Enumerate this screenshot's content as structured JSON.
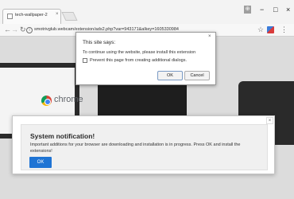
{
  "browser": {
    "tab": {
      "title": "tech-wallpaper-2",
      "close": "×"
    },
    "window": {
      "profile": "⊕",
      "minimize": "−",
      "maximize": "□",
      "close": "×"
    },
    "toolbar": {
      "back": "←",
      "forward": "→",
      "reload": "↻",
      "star": "☆",
      "menu": "⋮"
    },
    "address_bar": {
      "info": "i",
      "url": "smotrivglub.webcam/extension/ads2.php?var=943171&alkey=1605330984"
    }
  },
  "page": {
    "logo_text": "chrome"
  },
  "alert": {
    "title": "This site says:",
    "close": "×",
    "message": "To continue using the website, please install this extension",
    "checkbox_label": "Prevent this page from creating additional dialogs.",
    "ok": "OK",
    "cancel": "Cancel"
  },
  "notification": {
    "close": "×",
    "title": "System notification!",
    "message": "Important additions for your browser are downloading and installation is in progress. Press OK and install the extensions!",
    "ok": "OK"
  }
}
